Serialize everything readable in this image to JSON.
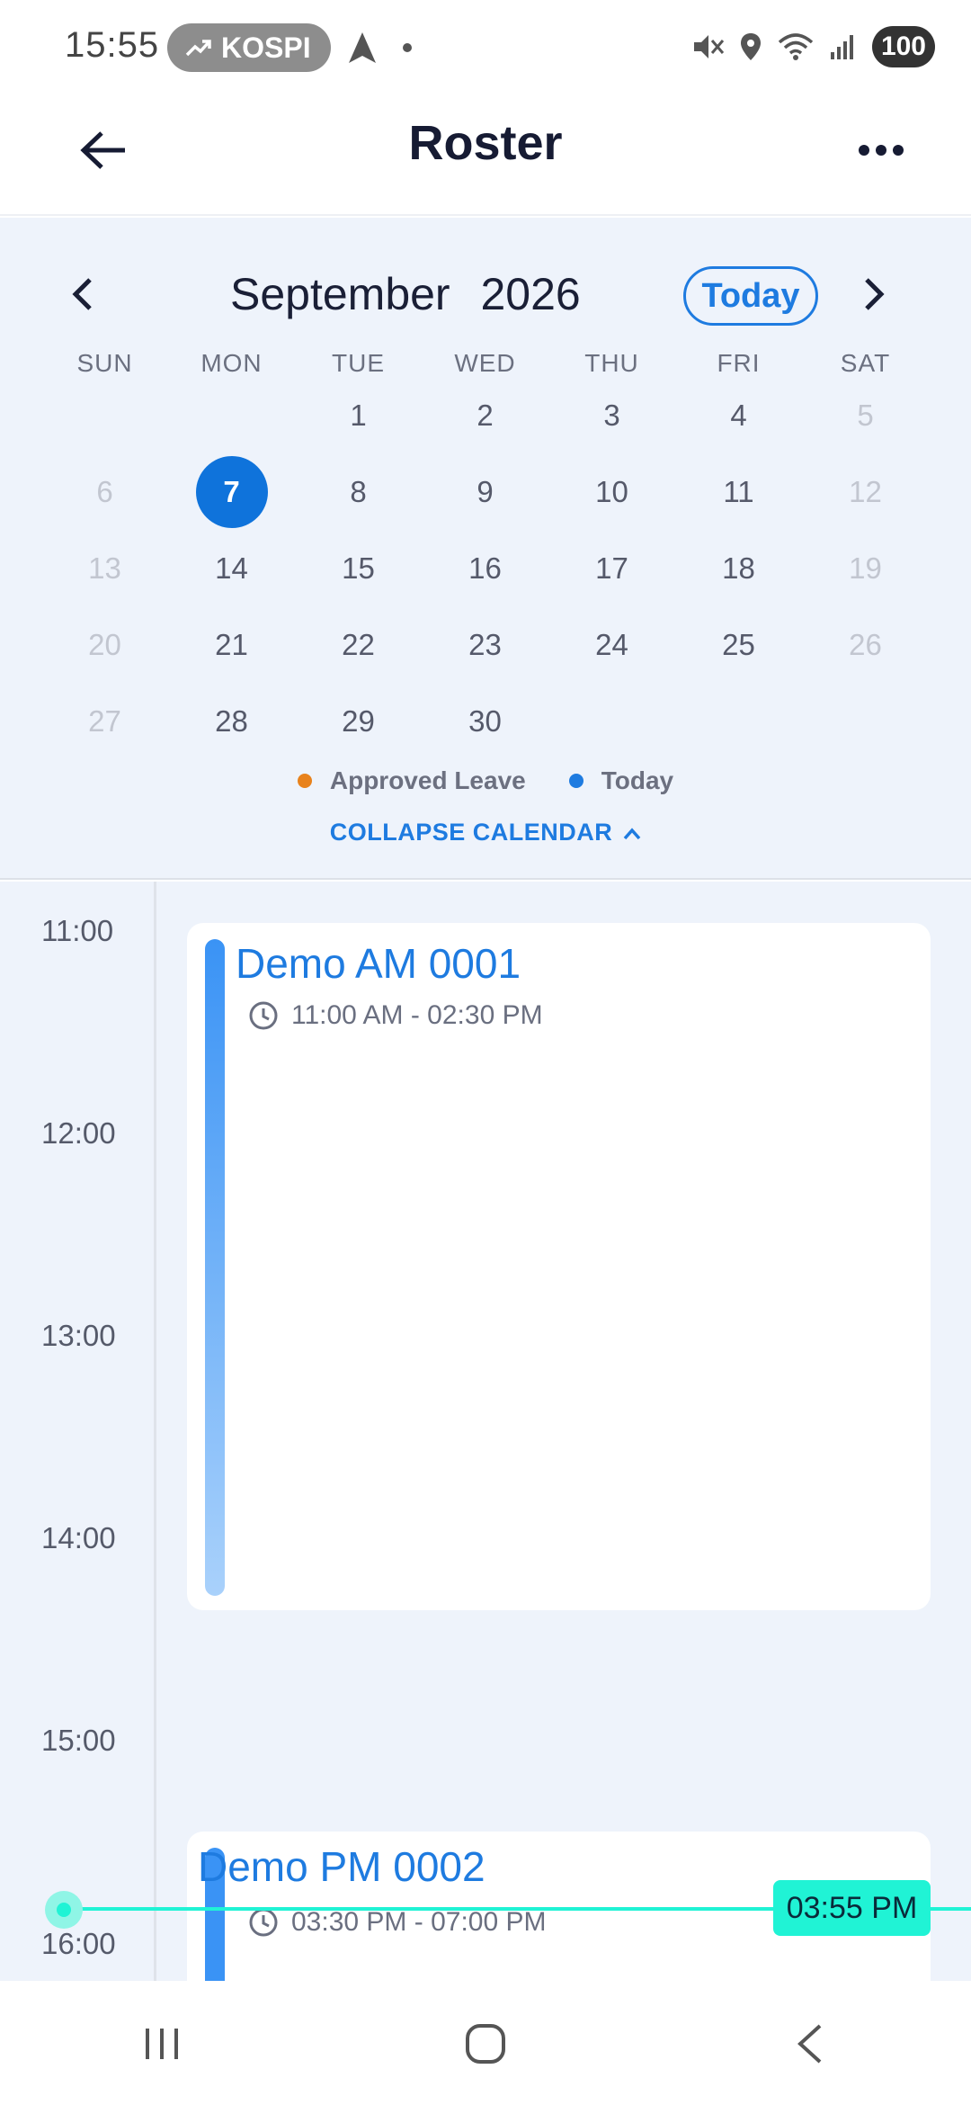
{
  "status_bar": {
    "time": "15:55",
    "ticker": "KOSPI",
    "battery": "100"
  },
  "header": {
    "title": "Roster"
  },
  "calendar": {
    "month": "September",
    "year": "2026",
    "today_label": "Today",
    "weekdays": [
      "SUN",
      "MON",
      "TUE",
      "WED",
      "THU",
      "FRI",
      "SAT"
    ],
    "weeks": [
      [
        "",
        "",
        "1",
        "2",
        "3",
        "4",
        "5"
      ],
      [
        "6",
        "7",
        "8",
        "9",
        "10",
        "11",
        "12"
      ],
      [
        "13",
        "14",
        "15",
        "16",
        "17",
        "18",
        "19"
      ],
      [
        "20",
        "21",
        "22",
        "23",
        "24",
        "25",
        "26"
      ],
      [
        "27",
        "28",
        "29",
        "30",
        "",
        "",
        ""
      ]
    ],
    "selected_day": "7",
    "legend": {
      "approved_leave": "Approved Leave",
      "today": "Today",
      "approved_leave_color": "#e8821c",
      "today_color": "#1e7be0"
    },
    "collapse_label": "COLLAPSE CALENDAR"
  },
  "timeline": {
    "hours": [
      "11:00",
      "12:00",
      "13:00",
      "14:00",
      "15:00",
      "16:00"
    ],
    "events": [
      {
        "title": "Demo AM 0001",
        "time": "11:00 AM - 02:30 PM"
      },
      {
        "title": "Demo PM 0002",
        "time": "03:30 PM - 07:00 PM"
      }
    ],
    "now_label": "03:55 PM"
  },
  "colors": {
    "accent": "#1e7be0",
    "now_indicator": "#20f3d5",
    "calendar_bg": "#eef3fb"
  }
}
